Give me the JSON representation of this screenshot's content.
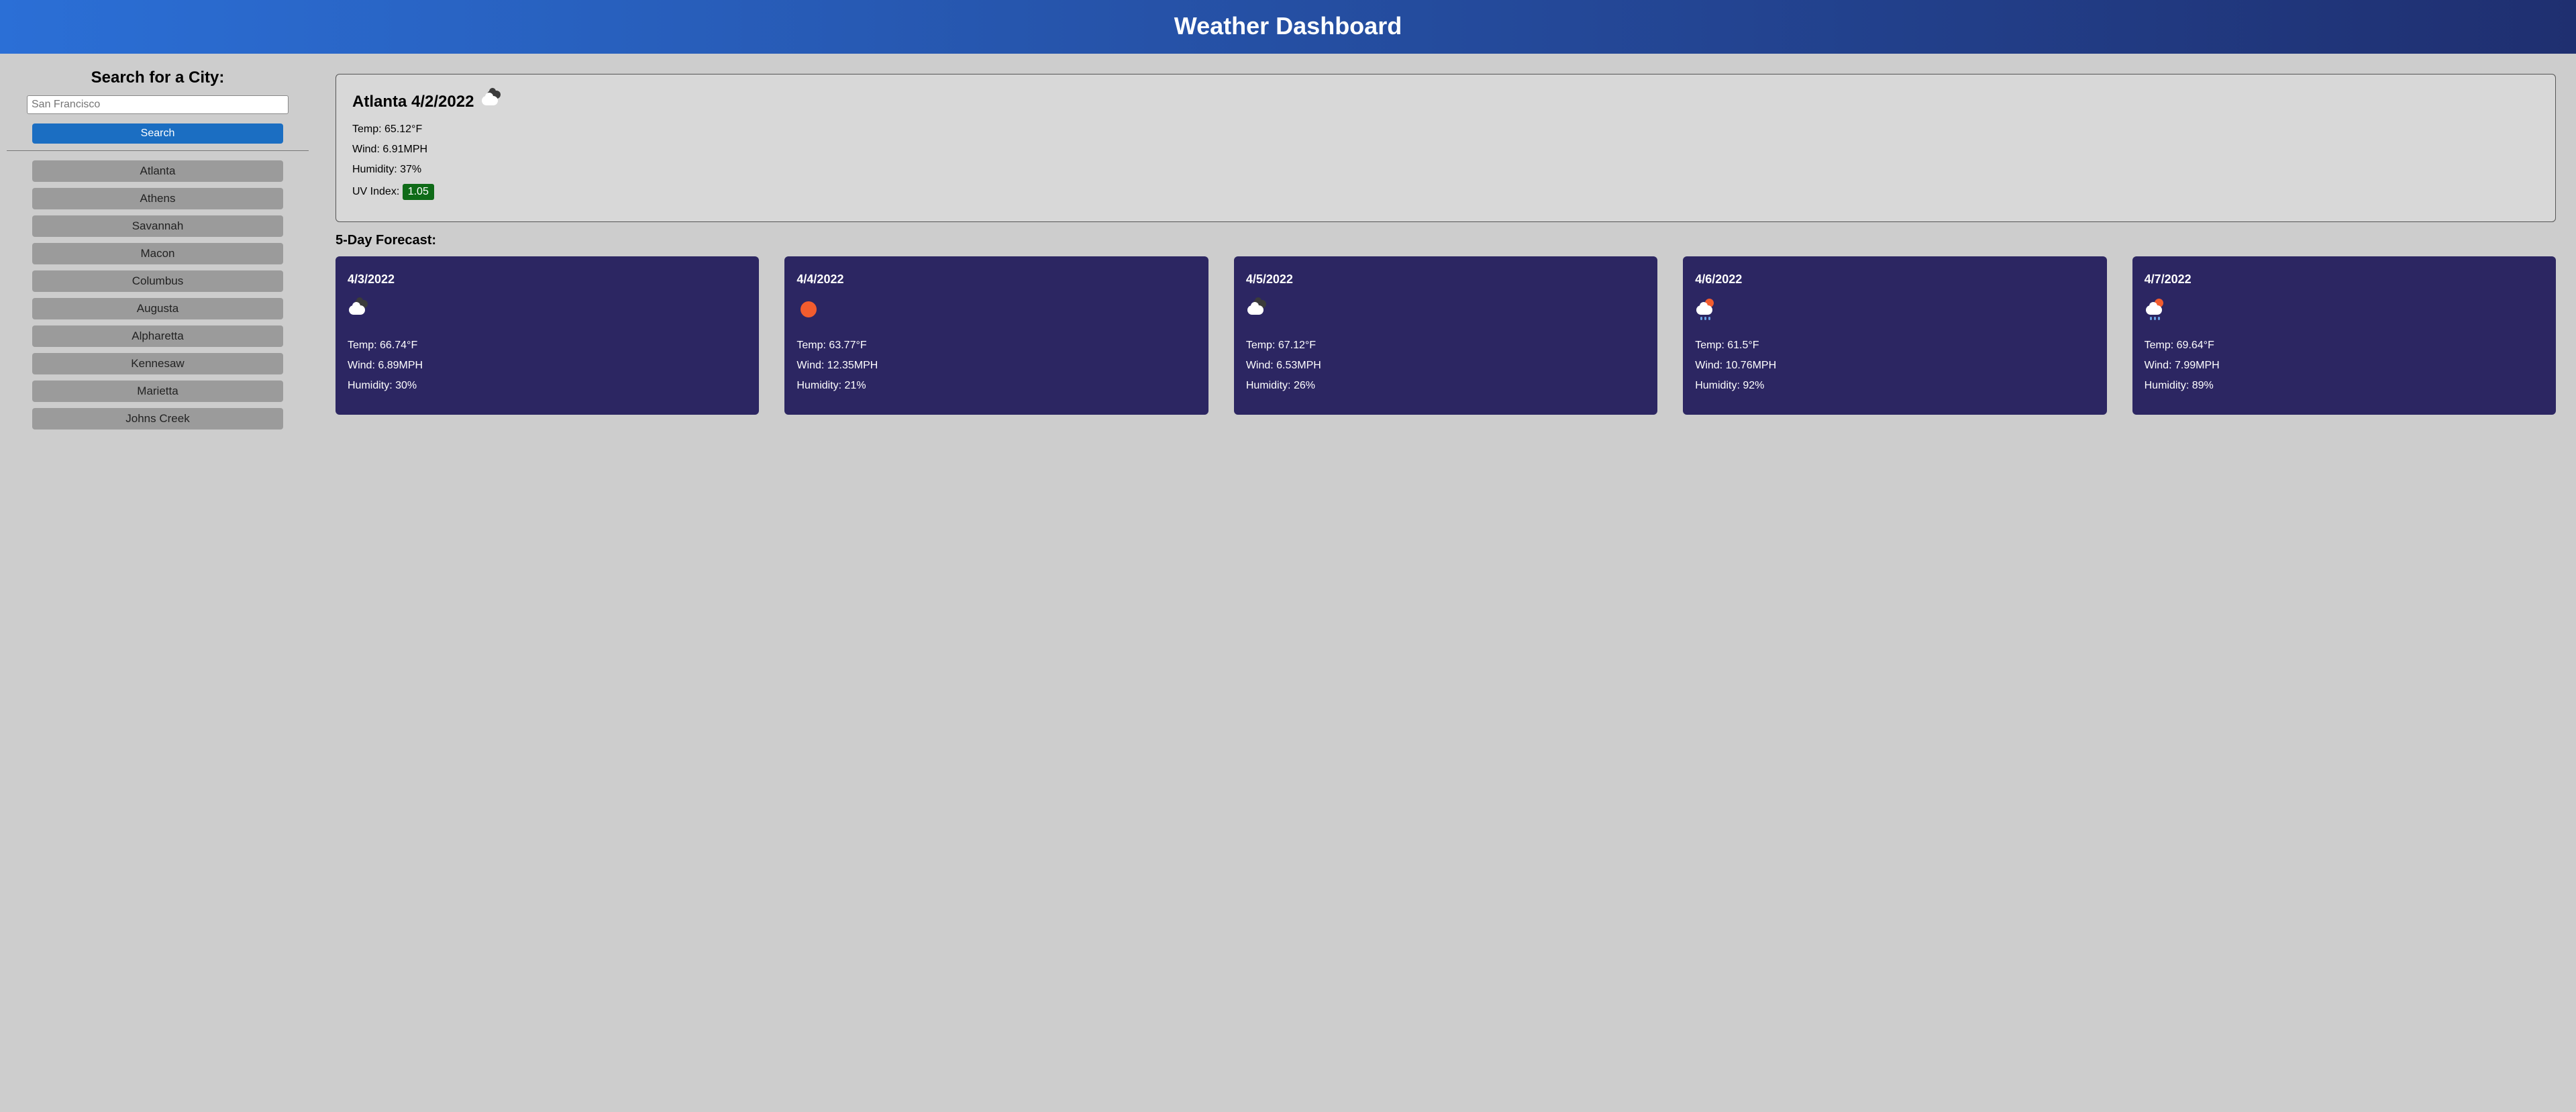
{
  "header": {
    "title": "Weather Dashboard"
  },
  "sidebar": {
    "search_label": "Search for a City:",
    "placeholder": "San Francisco",
    "search_btn": "Search",
    "history": [
      "Atlanta",
      "Athens",
      "Savannah",
      "Macon",
      "Columbus",
      "Augusta",
      "Alpharetta",
      "Kennesaw",
      "Marietta",
      "Johns Creek"
    ]
  },
  "current": {
    "city": "Atlanta",
    "date": "4/2/2022",
    "icon": "clouds",
    "temp_label": "Temp: 65.12°F",
    "wind_label": "Wind: 6.91MPH",
    "humidity_label": "Humidity: 37%",
    "uv_label": "UV Index: ",
    "uv_value": "1.05",
    "uv_color": "#0f6b18"
  },
  "forecast_title": "5-Day Forecast:",
  "forecast": [
    {
      "date": "4/3/2022",
      "icon": "clouds",
      "temp": "Temp: 66.74°F",
      "wind": "Wind: 6.89MPH",
      "humidity": "Humidity: 30%"
    },
    {
      "date": "4/4/2022",
      "icon": "clear",
      "temp": "Temp: 63.77°F",
      "wind": "Wind: 12.35MPH",
      "humidity": "Humidity: 21%"
    },
    {
      "date": "4/5/2022",
      "icon": "clouds",
      "temp": "Temp: 67.12°F",
      "wind": "Wind: 6.53MPH",
      "humidity": "Humidity: 26%"
    },
    {
      "date": "4/6/2022",
      "icon": "sun-rain",
      "temp": "Temp: 61.5°F",
      "wind": "Wind: 10.76MPH",
      "humidity": "Humidity: 92%"
    },
    {
      "date": "4/7/2022",
      "icon": "sun-rain",
      "temp": "Temp: 69.64°F",
      "wind": "Wind: 7.99MPH",
      "humidity": "Humidity: 89%"
    }
  ]
}
